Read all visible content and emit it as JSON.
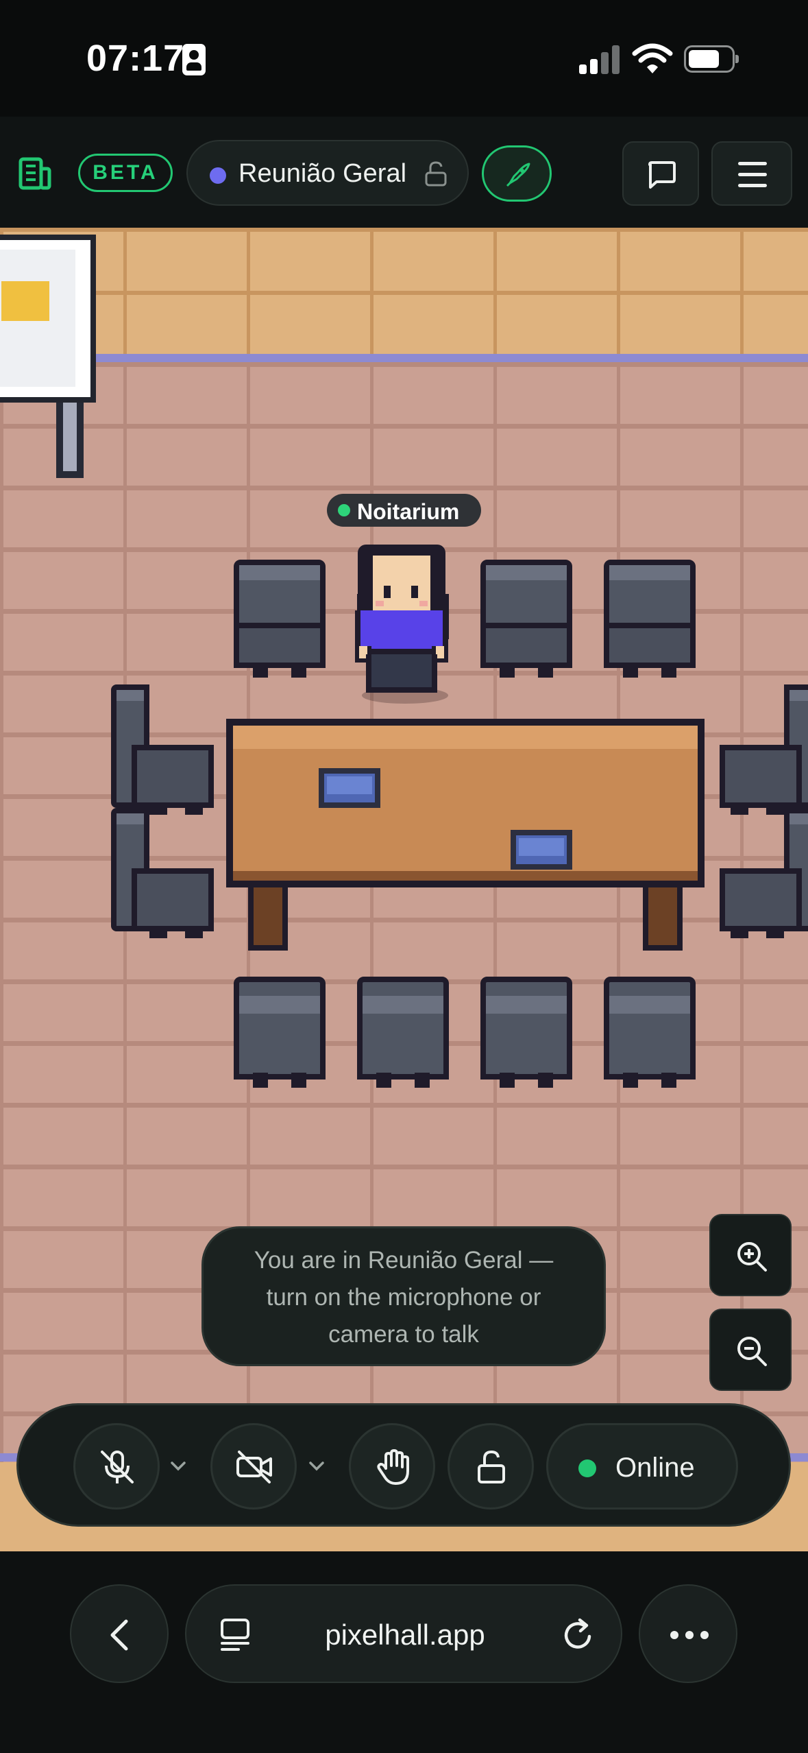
{
  "status_bar": {
    "time": "07:17"
  },
  "header": {
    "beta_label": "BETA",
    "room": {
      "name": "Reunião Geral"
    }
  },
  "avatar": {
    "name": "Noitarium"
  },
  "toast": {
    "lines": [
      "You are in Reunião Geral —",
      "turn on the microphone or",
      "camera to talk"
    ]
  },
  "controls": {
    "status_label": "Online"
  },
  "browser": {
    "url": "pixelhall.app"
  },
  "colors": {
    "accent": "#22c772",
    "room_dot": "#6e6cf0",
    "shirt": "#5842e8"
  }
}
